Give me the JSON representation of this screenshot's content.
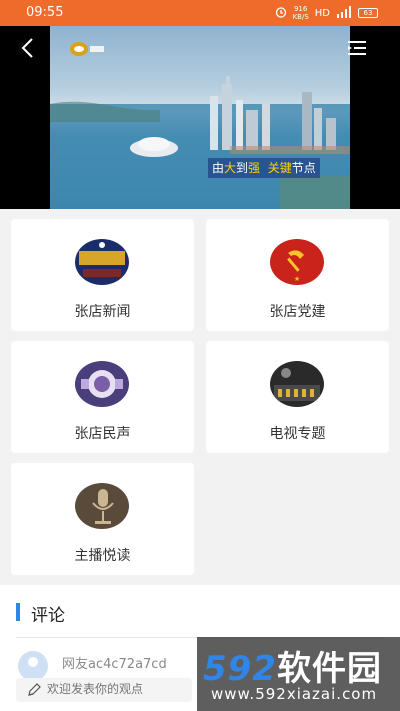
{
  "status_bar": {
    "time": "09:55",
    "net_speed": "916",
    "net_unit": "KB/S",
    "hd": "HD",
    "signal": "4G",
    "battery": "63"
  },
  "video": {
    "caption_parts": [
      "由",
      "大",
      "到",
      "强",
      "关键",
      "节点"
    ],
    "caption_highlight_color": "#ffd400"
  },
  "grid": {
    "items": [
      {
        "label": "张店新闻",
        "icon": "news-icon"
      },
      {
        "label": "张店党建",
        "icon": "party-emblem-icon"
      },
      {
        "label": "张店民声",
        "icon": "people-voice-icon"
      },
      {
        "label": "电视专题",
        "icon": "tv-studio-icon"
      },
      {
        "label": "主播悦读",
        "icon": "microphone-icon"
      }
    ]
  },
  "comments": {
    "title": "评论",
    "accent": "#2f86e8",
    "first": {
      "username": "网友ac4c72a7cd"
    },
    "input_placeholder": "欢迎发表你的观点"
  },
  "watermark": {
    "number": "592",
    "brand": "软件园",
    "url": "www.592xiazai.com"
  }
}
